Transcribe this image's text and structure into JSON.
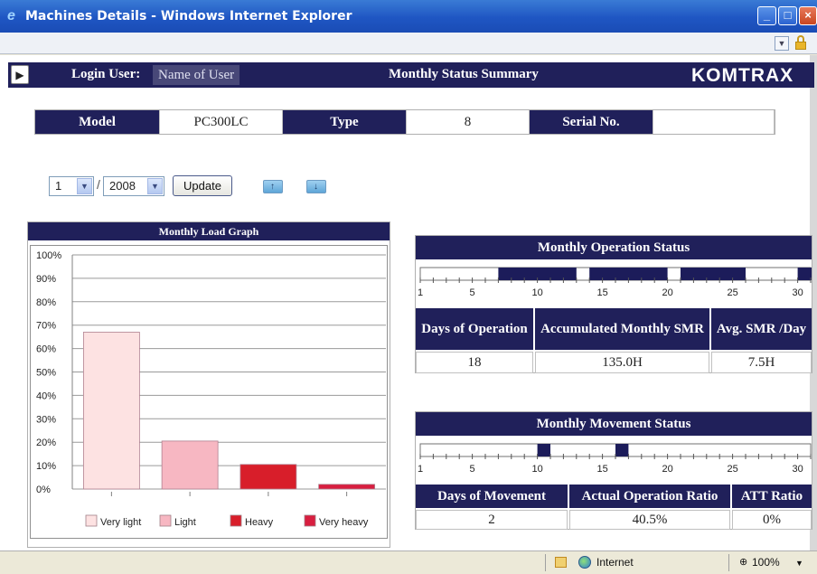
{
  "window": {
    "title": "Machines Details - Windows Internet Explorer",
    "controls": [
      "minimize",
      "maximize",
      "close"
    ]
  },
  "header": {
    "login_label": "Login User:",
    "user_name": "Name of User",
    "title": "Monthly Status Summary",
    "brand": "KOMTRAX"
  },
  "machine": {
    "model_label": "Model",
    "model_value": "PC300LC",
    "type_label": "Type",
    "type_value": "8",
    "serial_label": "Serial No.",
    "serial_value": ""
  },
  "period": {
    "month": "1",
    "separator": "/",
    "year": "2008",
    "update_label": "Update"
  },
  "load_graph": {
    "title": "Monthly Load Graph"
  },
  "chart_data": {
    "type": "bar",
    "title": "Monthly Load Graph",
    "categories": [
      "Very light",
      "Light",
      "Heavy",
      "Very heavy"
    ],
    "values": [
      67,
      20.5,
      10.5,
      2
    ],
    "colors": [
      "#fde2e2",
      "#f7b7c2",
      "#d81e2a",
      "#d81e3f"
    ],
    "ylim": [
      0,
      100
    ],
    "yticks": [
      "0%",
      "10%",
      "20%",
      "30%",
      "40%",
      "50%",
      "60%",
      "70%",
      "80%",
      "90%",
      "100%"
    ],
    "grid": true,
    "legend": "bottom"
  },
  "operation": {
    "title": "Monthly Operation Status",
    "scale_labels": [
      "1",
      "5",
      "10",
      "15",
      "20",
      "25",
      "30"
    ],
    "days_active_ranges": [
      [
        7,
        12
      ],
      [
        14,
        19
      ],
      [
        21,
        25
      ],
      [
        30,
        31
      ]
    ],
    "col1_label": "Days of Operation",
    "col2_label": "Accumulated Monthly SMR",
    "col3_label": "Avg. SMR /Day",
    "days": "18",
    "smr": "135.0H",
    "avg": "7.5H"
  },
  "movement": {
    "title": "Monthly Movement Status",
    "scale_labels": [
      "1",
      "5",
      "10",
      "15",
      "20",
      "25",
      "30"
    ],
    "days_active_ranges": [
      [
        10,
        10
      ],
      [
        16,
        16
      ]
    ],
    "col1_label": "Days of Movement",
    "col2_label": "Actual Operation Ratio",
    "col3_label": "ATT Ratio",
    "days": "2",
    "ratio": "40.5%",
    "att": "0%"
  },
  "statusbar": {
    "zone": "Internet",
    "zoom": "100%"
  },
  "colors": {
    "navy": "#20205a",
    "bar_fill": "#1c1c5a"
  }
}
